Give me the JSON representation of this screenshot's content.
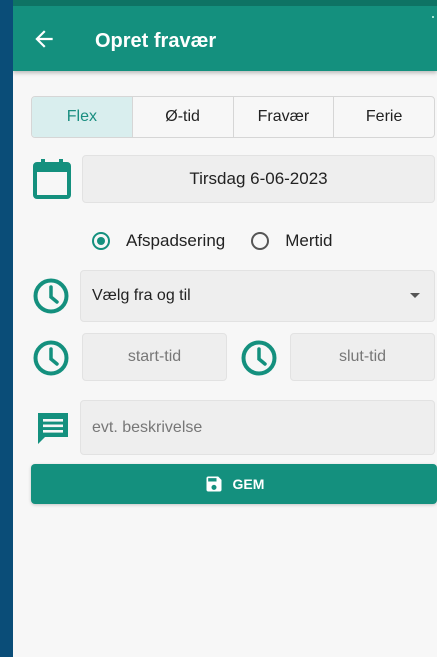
{
  "colors": {
    "primary": "#14907e",
    "frame": "#0a4d78",
    "tab_active_bg": "#d9eeee"
  },
  "header": {
    "title": "Opret fravær",
    "back_icon": "arrow-left-icon"
  },
  "tabs": [
    {
      "label": "Flex",
      "active": true
    },
    {
      "label": "Ø-tid",
      "active": false
    },
    {
      "label": "Fravær",
      "active": false
    },
    {
      "label": "Ferie",
      "active": false
    }
  ],
  "date": {
    "icon": "calendar-icon",
    "value": "Tirsdag 6-06-2023"
  },
  "type_radio": {
    "options": [
      {
        "label": "Afspadsering",
        "checked": true
      },
      {
        "label": "Mertid",
        "checked": false
      }
    ]
  },
  "time_select": {
    "icon": "clock-icon",
    "value": "Vælg fra og til"
  },
  "start_time": {
    "icon": "clock-icon",
    "placeholder": "start-tid"
  },
  "end_time": {
    "icon": "clock-icon",
    "placeholder": "slut-tid"
  },
  "description": {
    "icon": "message-icon",
    "placeholder": "evt. beskrivelse"
  },
  "save_button": {
    "label": "GEM",
    "icon": "floppy-disk-icon"
  }
}
